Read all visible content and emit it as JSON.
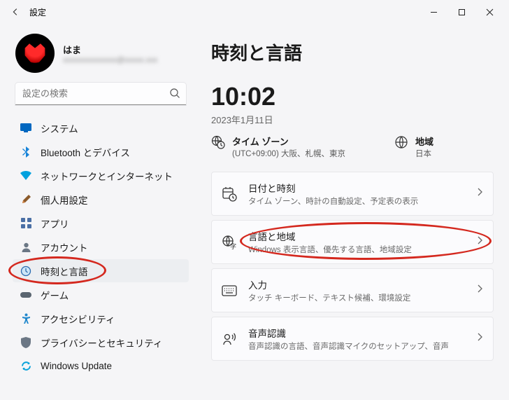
{
  "window": {
    "title": "設定"
  },
  "profile": {
    "name": "はま",
    "email": "xxxxxxxxxxxxxx@xxxxx.xxx"
  },
  "search": {
    "placeholder": "設定の検索"
  },
  "nav": [
    {
      "label": "システム"
    },
    {
      "label": "Bluetooth とデバイス"
    },
    {
      "label": "ネットワークとインターネット"
    },
    {
      "label": "個人用設定"
    },
    {
      "label": "アプリ"
    },
    {
      "label": "アカウント"
    },
    {
      "label": "時刻と言語"
    },
    {
      "label": "ゲーム"
    },
    {
      "label": "アクセシビリティ"
    },
    {
      "label": "プライバシーとセキュリティ"
    },
    {
      "label": "Windows Update"
    }
  ],
  "main": {
    "title": "時刻と言語",
    "clock": "10:02",
    "date": "2023年1月11日",
    "summary": {
      "tz_label": "タイム ゾーン",
      "tz_value": "(UTC+09:00) 大阪、札幌、東京",
      "region_label": "地域",
      "region_value": "日本"
    },
    "cards": [
      {
        "title": "日付と時刻",
        "desc": "タイム ゾーン、時計の自動設定、予定表の表示"
      },
      {
        "title": "言語と地域",
        "desc": "Windows 表示言語、優先する言語、地域設定"
      },
      {
        "title": "入力",
        "desc": "タッチ キーボード、テキスト候補、環境設定"
      },
      {
        "title": "音声認識",
        "desc": "音声認識の言語、音声認識マイクのセットアップ、音声"
      }
    ]
  },
  "annotations": {
    "highlight_nav_index": 6,
    "highlight_card_index": 1,
    "highlight_color": "#d4281e"
  }
}
